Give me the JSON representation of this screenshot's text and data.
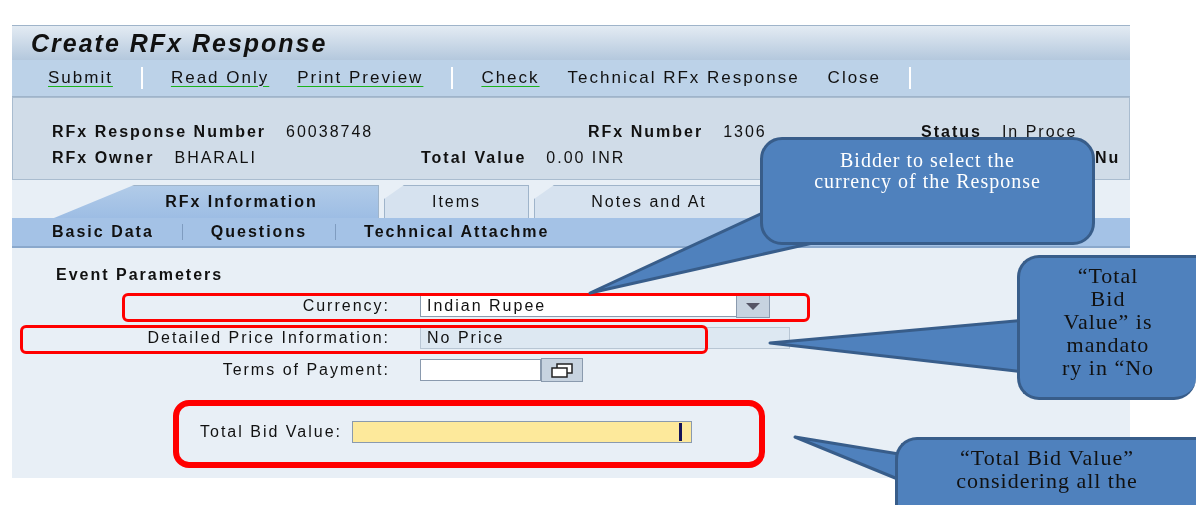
{
  "window": {
    "title": "Create RFx Response"
  },
  "toolbar": {
    "groups": [
      [
        {
          "label": "Submit",
          "underlined": true
        }
      ],
      [
        {
          "label": "Read Only",
          "underlined": true
        },
        {
          "label": "Print Preview",
          "underlined": true
        }
      ],
      [
        {
          "label": "Check",
          "underlined": true
        },
        {
          "label": "Technical RFx Response",
          "underlined": false
        },
        {
          "label": "Close",
          "underlined": false
        }
      ]
    ]
  },
  "header": {
    "rows": [
      [
        {
          "label": "RFx Response Number",
          "value": "60038748"
        },
        {
          "label": "RFx Number",
          "value": "1306"
        },
        {
          "label": "Status",
          "value": "In Proce"
        }
      ],
      [
        {
          "label": "RFx Owner",
          "value": "BHARALI"
        },
        {
          "label": "Total Value",
          "value": "0.00 INR"
        },
        {
          "label": "Nu"
        }
      ]
    ]
  },
  "tabs": [
    {
      "label": "RFx Information",
      "selected": true
    },
    {
      "label": "Items",
      "selected": false
    },
    {
      "label": "Notes and At",
      "selected": false
    }
  ],
  "subtabs": [
    {
      "label": "Basic Data"
    },
    {
      "label": "Questions"
    },
    {
      "label": "Technical Attachme"
    }
  ],
  "section": {
    "title": "Event Parameters"
  },
  "fields": [
    {
      "label": "Currency:",
      "kind": "dropdown",
      "value": "Indian Rupee"
    },
    {
      "label": "Detailed Price Information:",
      "kind": "readonly",
      "value": "No Price"
    },
    {
      "label": "Terms of Payment:",
      "kind": "valuehelp"
    },
    {
      "label": "Total Bid Value:",
      "kind": "required"
    }
  ],
  "callouts": [
    {
      "text": "Bidder to select the currency of the Response"
    },
    {
      "text": "“Total Bid Value” is mandato ry in “No"
    },
    {
      "text": "“Total Bid Value” considering all the"
    }
  ]
}
